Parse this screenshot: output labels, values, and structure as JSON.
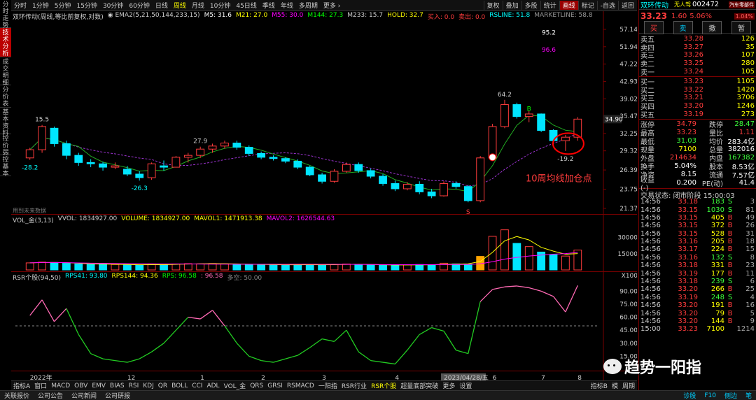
{
  "side_tabs": [
    {
      "label": "分时走势",
      "active": false
    },
    {
      "label": "技术分析",
      "active": true
    },
    {
      "label": "成交明细",
      "active": false
    },
    {
      "label": "分价表",
      "active": false
    },
    {
      "label": "基本资料",
      "active": false
    },
    {
      "label": "控价弱",
      "active": false
    },
    {
      "label": "控基本",
      "active": false
    }
  ],
  "periods": [
    "分时",
    "1分钟",
    "5分钟",
    "15分钟",
    "30分钟",
    "60分钟",
    "日线",
    "周线",
    "月线",
    "10分钟",
    "45日线",
    "季线",
    "年线",
    "多周期",
    "更多 ›"
  ],
  "selected_period": "周线",
  "right_buttons": [
    {
      "label": "复权",
      "on": false
    },
    {
      "label": "叠加",
      "on": false
    },
    {
      "label": "多股",
      "on": false
    },
    {
      "label": "统计",
      "on": false
    },
    {
      "label": "画线",
      "on": true
    },
    {
      "label": "标记",
      "on": false
    },
    {
      "label": "-自选",
      "on": false
    },
    {
      "label": "返回",
      "on": false
    }
  ],
  "legend1": [
    {
      "text": "双环传动(周线,等比前复权,对数)",
      "color": "#cccccc"
    },
    {
      "text": "◉ EMA2(5,21,50,144,233,15)",
      "color": "#cccccc"
    },
    {
      "text": "M5: 31.6",
      "color": "#ffffff"
    },
    {
      "text": "M21: 27.0",
      "color": "#ffff00"
    },
    {
      "text": "M55: 30.0",
      "color": "#ff00ff"
    },
    {
      "text": "M144: 27.3",
      "color": "#00ff00"
    },
    {
      "text": "M233: 15.7",
      "color": "#cccccc"
    },
    {
      "text": "HOLD: 32.7",
      "color": "#ffff00"
    },
    {
      "text": "买入: 0.0",
      "color": "#ff3c3c"
    },
    {
      "text": "卖出: 0.0",
      "color": "#ff3c3c"
    },
    {
      "text": "RSLINE: 51.8",
      "color": "#00ffff"
    },
    {
      "text": "MARKETLINE: 58.8",
      "color": "#999999"
    }
  ],
  "legend2": [
    {
      "text": "VOL_金(3,13)",
      "color": "#cccccc"
    },
    {
      "text": "VVOL: 1834927.00",
      "color": "#cccccc"
    },
    {
      "text": "VOLUME: 1834927.00",
      "color": "#ffff00"
    },
    {
      "text": "MAVOL1: 1471913.38",
      "color": "#ffff00"
    },
    {
      "text": "MAVOL2: 1626544.63",
      "color": "#ff00ff"
    }
  ],
  "legend3": [
    {
      "text": "RSR个股(94,50)",
      "color": "#cccccc"
    },
    {
      "text": "RPS41: 93.80",
      "color": "#00ffff"
    },
    {
      "text": "RPS144: 94.36",
      "color": "#ffff00"
    },
    {
      "text": "RPS: 96.58",
      "color": "#00ff00"
    },
    {
      "text": ": 96.58",
      "color": "#ff69b4"
    },
    {
      "text": "多空: 50.00",
      "color": "#888888"
    }
  ],
  "price_axis": [
    "57.14",
    "51.94",
    "47.22",
    "42.93",
    "39.02",
    "35.47",
    "32.25",
    "29.32",
    "26.39",
    "23.75",
    "21.37"
  ],
  "current_price_tag": "34.90",
  "vol_axis": [
    "30000",
    "15000",
    "X100"
  ],
  "rsr_axis": [
    "90.00",
    "75.00",
    "60.00",
    "45.00",
    "30.00",
    "15.00"
  ],
  "chart_annotations": {
    "high1": "15.5",
    "low1": "-28.2",
    "low2": "-26.3",
    "high2": "27.9",
    "high3": "64.2",
    "low3": "-19.2",
    "r1": "95.2",
    "r2": "96.6",
    "future_note": "用到未来数据",
    "callout": "10周均线加仓点",
    "marker_s": "S",
    "marker_b": "B"
  },
  "x_axis": [
    "2022年",
    "12",
    "1",
    "2",
    "3",
    "4",
    "2023/04/28/五",
    "6",
    "7",
    "8"
  ],
  "chart_data": {
    "type": "candlestick",
    "period": "weekly",
    "candles": [
      [
        28.2,
        29.8,
        27.9,
        29.5
      ],
      [
        29.5,
        33.8,
        29.0,
        33.5
      ],
      [
        33.2,
        33.5,
        30.0,
        30.5
      ],
      [
        30.5,
        31.0,
        28.0,
        28.6
      ],
      [
        28.6,
        29.0,
        27.0,
        27.5
      ],
      [
        27.5,
        28.0,
        26.8,
        27.3
      ],
      [
        27.3,
        27.6,
        26.3,
        26.8
      ],
      [
        26.8,
        27.5,
        26.5,
        27.0
      ],
      [
        26.5,
        27.0,
        25.5,
        25.8
      ],
      [
        25.8,
        26.2,
        24.9,
        25.3
      ],
      [
        25.3,
        27.5,
        25.0,
        27.3
      ],
      [
        27.0,
        27.8,
        26.3,
        26.8
      ],
      [
        26.8,
        28.5,
        26.8,
        28.3
      ],
      [
        28.3,
        29.0,
        27.5,
        28.6
      ],
      [
        28.6,
        30.0,
        28.2,
        29.6
      ],
      [
        29.6,
        30.5,
        29.0,
        30.1
      ],
      [
        30.1,
        31.0,
        29.7,
        30.6
      ],
      [
        30.6,
        31.0,
        29.5,
        29.9
      ],
      [
        29.9,
        30.2,
        28.5,
        28.9
      ],
      [
        28.9,
        29.2,
        28.0,
        28.3
      ],
      [
        28.3,
        28.6,
        27.8,
        28.1
      ],
      [
        28.1,
        28.3,
        27.4,
        27.7
      ],
      [
        27.7,
        28.0,
        26.5,
        26.8
      ],
      [
        26.8,
        27.0,
        25.5,
        25.7
      ],
      [
        25.7,
        26.0,
        24.5,
        24.8
      ],
      [
        24.8,
        26.5,
        24.6,
        26.2
      ],
      [
        26.2,
        27.5,
        26.0,
        27.2
      ],
      [
        27.2,
        27.5,
        26.0,
        26.3
      ],
      [
        26.3,
        26.6,
        25.2,
        25.5
      ],
      [
        25.5,
        25.8,
        24.2,
        24.5
      ],
      [
        24.5,
        24.9,
        23.5,
        23.8
      ],
      [
        23.8,
        24.7,
        23.6,
        24.4
      ],
      [
        24.4,
        24.8,
        23.1,
        23.4
      ],
      [
        23.4,
        23.8,
        22.6,
        22.9
      ],
      [
        22.9,
        24.8,
        22.8,
        24.5
      ],
      [
        24.5,
        24.8,
        23.8,
        24.1
      ],
      [
        24.1,
        24.3,
        22.1,
        22.3
      ],
      [
        22.3,
        28.5,
        22.1,
        28.2
      ],
      [
        28.2,
        34.0,
        28.0,
        33.5
      ],
      [
        33.5,
        38.8,
        33.2,
        37.8
      ],
      [
        37.8,
        38.2,
        35.0,
        35.4
      ],
      [
        35.4,
        36.5,
        34.3,
        35.9
      ],
      [
        35.9,
        36.0,
        32.5,
        32.8
      ],
      [
        32.8,
        33.0,
        30.5,
        31.0
      ],
      [
        31.0,
        32.0,
        29.3,
        31.6
      ],
      [
        31.6,
        35.3,
        31.0,
        34.9
      ]
    ],
    "volume": [
      650,
      720,
      690,
      610,
      560,
      510,
      540,
      500,
      470,
      450,
      520,
      490,
      550,
      580,
      560,
      590,
      560,
      530,
      510,
      490,
      470,
      460,
      500,
      480,
      450,
      520,
      550,
      500,
      470,
      460,
      440,
      470,
      500,
      450,
      620,
      560,
      520,
      1250,
      3100,
      3700,
      2450,
      2150,
      1650,
      1400,
      1280,
      1834
    ],
    "rsr_rps": [
      62,
      80,
      55,
      70,
      40,
      18,
      12,
      10,
      8,
      12,
      20,
      30,
      45,
      60,
      58,
      68,
      50,
      30,
      15,
      10,
      8,
      12,
      16,
      25,
      35,
      32,
      45,
      20,
      10,
      8,
      6,
      22,
      40,
      48,
      44,
      22,
      18,
      78,
      92,
      95,
      96,
      94,
      90,
      84,
      66,
      96.58
    ],
    "ma_levels": {
      "M5": 31.6,
      "M21": 27.0,
      "M55": 30.0,
      "M144": 27.3,
      "M233": 15.7
    },
    "y_axis_scale": "log",
    "ylim": [
      21.37,
      57.14
    ]
  },
  "indicator_tabs": [
    "指标A",
    "窗口",
    "MACD",
    "OBV",
    "EMV",
    "BIAS",
    "RSI",
    "KDJ",
    "QR",
    "BOLL",
    "CCI",
    "ADL",
    "VOL_金",
    "QRS",
    "GRSI",
    "RSMACD",
    "一阳指",
    "RSR行业",
    "RSR个股",
    "超量底部突破",
    "更多",
    "设置"
  ],
  "selected_indicator": "RSR个股",
  "indicator_right": [
    "指标B",
    "模",
    "周期"
  ],
  "status_bar": [
    "关联报价",
    "公司公告",
    "公司新闻",
    "公司研报"
  ],
  "status_right": [
    "诊股",
    "F10",
    "侧边",
    "笔"
  ],
  "stock": {
    "name": "双环传动",
    "code": "002472",
    "concept": "无人驾",
    "sector": "汽车零部件",
    "price": "33.23",
    "change": "1.60",
    "pct": "5.06%",
    "sector_pct": "1.04%"
  },
  "trade_buttons": [
    "买",
    "卖",
    "撤",
    "暂"
  ],
  "sell_orders": [
    {
      "label": "卖五",
      "price": "33.28",
      "vol": "126"
    },
    {
      "label": "卖四",
      "price": "33.27",
      "vol": "35"
    },
    {
      "label": "卖三",
      "price": "33.26",
      "vol": "107"
    },
    {
      "label": "卖二",
      "price": "33.25",
      "vol": "280"
    },
    {
      "label": "卖一",
      "price": "33.24",
      "vol": "105"
    }
  ],
  "buy_orders": [
    {
      "label": "买一",
      "price": "33.23",
      "vol": "1105"
    },
    {
      "label": "买二",
      "price": "33.22",
      "vol": "1420"
    },
    {
      "label": "买三",
      "price": "33.21",
      "vol": "3706"
    },
    {
      "label": "买四",
      "price": "33.20",
      "vol": "1246"
    },
    {
      "label": "买五",
      "price": "33.19",
      "vol": "273"
    }
  ],
  "stats": [
    {
      "k": "涨停",
      "v1": "34.79",
      "k2": "跌停",
      "v2": "28.47",
      "c1": "red",
      "c2": "green"
    },
    {
      "k": "最高",
      "v1": "33.23",
      "k2": "量比",
      "v2": "1.11",
      "c1": "red",
      "c2": "red"
    },
    {
      "k": "最低",
      "v1": "31.03",
      "k2": "均价",
      "v2": "283.4亿",
      "c1": "green",
      "c2": "white"
    },
    {
      "k": "现量",
      "v1": "7100",
      "k2": "总量",
      "v2": "382016",
      "c1": "yellow",
      "c2": "white"
    },
    {
      "k": "外盘",
      "v1": "214634",
      "k2": "内盘",
      "v2": "167382",
      "c1": "red",
      "c2": "green"
    },
    {
      "k": "换手",
      "v1": "5.04%",
      "k2": "股本",
      "v2": "8.53亿",
      "c1": "white",
      "c2": "white"
    },
    {
      "k": "净资",
      "v1": "8.15",
      "k2": "流通",
      "v2": "7.57亿",
      "c1": "white",
      "c2": "white"
    },
    {
      "k": "收益(-)",
      "v1": "0.200",
      "k2": "PE(动)",
      "v2": "41.4",
      "c1": "white",
      "c2": "white"
    }
  ],
  "trade_status": "交易状态: 闭市阶段 15:00:03",
  "ticks": [
    {
      "t": "14:56",
      "p": "33.18",
      "v": "183",
      "d": "S",
      "n": "3"
    },
    {
      "t": "14:56",
      "p": "33.15",
      "v": "1030",
      "d": "S",
      "n": "81"
    },
    {
      "t": "14:56",
      "p": "33.15",
      "v": "405",
      "d": "B",
      "n": "49"
    },
    {
      "t": "14:56",
      "p": "33.15",
      "v": "372",
      "d": "B",
      "n": "26"
    },
    {
      "t": "14:56",
      "p": "33.15",
      "v": "528",
      "d": "B",
      "n": "31"
    },
    {
      "t": "14:56",
      "p": "33.16",
      "v": "205",
      "d": "B",
      "n": "18"
    },
    {
      "t": "14:56",
      "p": "33.17",
      "v": "224",
      "d": "B",
      "n": "15"
    },
    {
      "t": "14:56",
      "p": "33.16",
      "v": "132",
      "d": "S",
      "n": "8"
    },
    {
      "t": "14:56",
      "p": "33.18",
      "v": "331",
      "d": "B",
      "n": "23"
    },
    {
      "t": "14:56",
      "p": "33.19",
      "v": "177",
      "d": "B",
      "n": "11"
    },
    {
      "t": "14:56",
      "p": "33.18",
      "v": "239",
      "d": "S",
      "n": "6"
    },
    {
      "t": "14:56",
      "p": "33.20",
      "v": "266",
      "d": "B",
      "n": "25"
    },
    {
      "t": "14:56",
      "p": "33.19",
      "v": "248",
      "d": "S",
      "n": "4"
    },
    {
      "t": "14:56",
      "p": "33.20",
      "v": "191",
      "d": "B",
      "n": "16"
    },
    {
      "t": "14:56",
      "p": "33.20",
      "v": "79",
      "d": "B",
      "n": "5"
    },
    {
      "t": "14:56",
      "p": "33.20",
      "v": "144",
      "d": "B",
      "n": "9"
    },
    {
      "t": "15:00",
      "p": "33.23",
      "v": "7100",
      "d": "",
      "n": "1214"
    }
  ],
  "watermark": "趋势一阳指"
}
